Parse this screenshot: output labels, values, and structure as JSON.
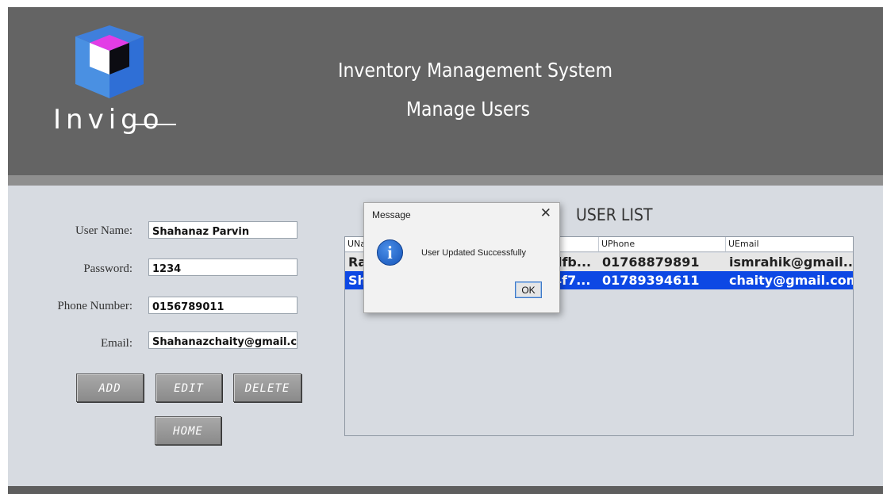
{
  "header": {
    "logo_text": "Invigo",
    "title": "Inventory Management System",
    "subtitle": "Manage Users"
  },
  "form": {
    "username_label": "User Name:",
    "username_value": "Shahanaz Parvin",
    "password_label": "Password:",
    "password_value": "1234",
    "phone_label": "Phone Number:",
    "phone_value": "0156789011",
    "email_label": "Email:",
    "email_value": "Shahanazchaity@gmail.com"
  },
  "buttons": {
    "add": "ADD",
    "edit": "EDIT",
    "delete": "DELETE",
    "home": "HOME"
  },
  "user_list": {
    "title": "USER LIST",
    "columns": [
      "UNa",
      "",
      "UPhone",
      "UEmail"
    ],
    "rows": [
      [
        "Ra",
        "dfb...",
        "01768879891",
        "ismrahik@gmail...."
      ],
      [
        "Sh",
        "4f7...",
        "01789394611",
        "chaity@gmail.com"
      ]
    ],
    "selected_row": 2
  },
  "dialog": {
    "title": "Message",
    "close_glyph": "✕",
    "icon": "info-icon",
    "message": "User Updated Successfully",
    "ok_label": "OK"
  },
  "colors": {
    "header_bg": "#646464",
    "body_bg": "#d7dbe1",
    "selection": "#0d48e4"
  }
}
